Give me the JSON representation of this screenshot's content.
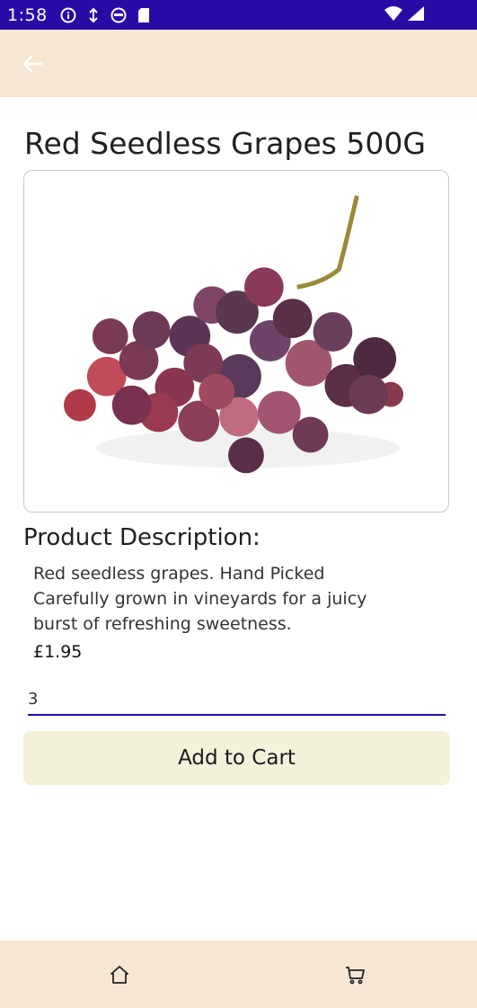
{
  "status_bar": {
    "time": "1:58"
  },
  "app_bar": {
    "back_icon": "arrow-left-icon"
  },
  "product": {
    "title": "Red Seedless Grapes 500G",
    "image_icon": "grapes-image",
    "description_heading": "Product Description:",
    "description_lines": [
      "Red seedless grapes. Hand Picked",
      "Carefully grown in vineyards for a juicy",
      "burst of refreshing sweetness."
    ],
    "price": "£1.95"
  },
  "quantity": {
    "value": "3"
  },
  "actions": {
    "add_to_cart_label": "Add to Cart"
  },
  "bottom_nav": {
    "home_icon": "home-icon",
    "cart_icon": "cart-icon"
  },
  "colors": {
    "accent": "#2a0aa6",
    "app_bar": "#f7e6d4",
    "button": "#f4f1da"
  }
}
